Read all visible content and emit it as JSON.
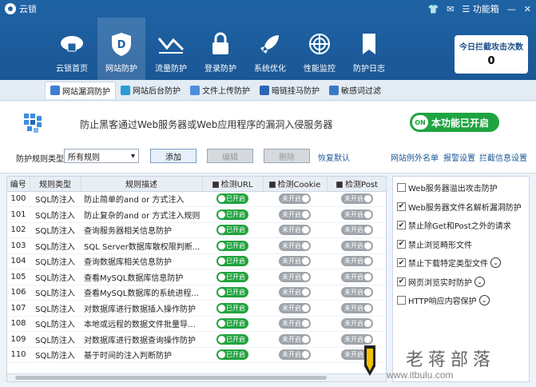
{
  "app": {
    "title": "云锁",
    "func_box": "功能箱"
  },
  "nav": [
    {
      "label": "云锁首页",
      "icon": "cloud-lock-icon",
      "active": false
    },
    {
      "label": "网站防护",
      "icon": "shield-icon",
      "active": true
    },
    {
      "label": "流量防护",
      "icon": "traffic-icon",
      "active": false
    },
    {
      "label": "登录防护",
      "icon": "lock-icon",
      "active": false
    },
    {
      "label": "系统优化",
      "icon": "rocket-icon",
      "active": false
    },
    {
      "label": "性能监控",
      "icon": "radar-icon",
      "active": false
    },
    {
      "label": "防护日志",
      "icon": "log-icon",
      "active": false
    }
  ],
  "counter": {
    "title": "今日拦截攻击次数",
    "value": "0"
  },
  "subtabs": [
    {
      "label": "网站漏洞防护",
      "active": true,
      "color": "#3d7fd0"
    },
    {
      "label": "网站后台防护",
      "active": false,
      "color": "#2a9ad8"
    },
    {
      "label": "文件上传防护",
      "active": false,
      "color": "#4d8de0"
    },
    {
      "label": "暗链挂马防护",
      "active": false,
      "color": "#2a66b8"
    },
    {
      "label": "敏感词过滤",
      "active": false,
      "color": "#3a78c4"
    }
  ],
  "header": {
    "description": "防止黑客通过Web服务器或Web应用程序的漏洞入侵服务器",
    "status_on": "ON",
    "status_text": "本功能已开启"
  },
  "controls": {
    "type_label": "防护规则类型",
    "type_value": "所有规则",
    "add": "添加",
    "edit": "编辑",
    "delete": "删除",
    "restore": "恢复默认",
    "link_exceptions": "网站例外名单",
    "link_alert": "报警设置",
    "link_block": "拦截信息设置"
  },
  "table": {
    "headers": {
      "id": "编号",
      "type": "规则类型",
      "desc": "规则描述",
      "url": "检测URL",
      "cookie": "检测Cookie",
      "post": "检测Post"
    },
    "on_label": "已开启",
    "off_label": "未开启",
    "rows": [
      {
        "id": "100",
        "type": "SQL防注入",
        "desc": "防止简单的and or 方式注入",
        "url": true,
        "cookie": false,
        "post": false
      },
      {
        "id": "101",
        "type": "SQL防注入",
        "desc": "防止复杂的and or 方式注入规则",
        "url": true,
        "cookie": false,
        "post": false
      },
      {
        "id": "102",
        "type": "SQL防注入",
        "desc": "查询服务器相关信息防护",
        "url": true,
        "cookie": false,
        "post": false
      },
      {
        "id": "103",
        "type": "SQL防注入",
        "desc": "SQL Server数据库散权限判断...",
        "url": true,
        "cookie": false,
        "post": false
      },
      {
        "id": "104",
        "type": "SQL防注入",
        "desc": "查询数据库相关信息防护",
        "url": true,
        "cookie": false,
        "post": false
      },
      {
        "id": "105",
        "type": "SQL防注入",
        "desc": "查看MySQL数据库信息防护",
        "url": true,
        "cookie": false,
        "post": false
      },
      {
        "id": "106",
        "type": "SQL防注入",
        "desc": "查看MySQL数据库的系统进程...",
        "url": true,
        "cookie": false,
        "post": false
      },
      {
        "id": "107",
        "type": "SQL防注入",
        "desc": "对数据库进行数据插入操作防护",
        "url": true,
        "cookie": false,
        "post": false
      },
      {
        "id": "108",
        "type": "SQL防注入",
        "desc": "本地或远程的数据文件批量导入...",
        "url": true,
        "cookie": false,
        "post": false
      },
      {
        "id": "109",
        "type": "SQL防注入",
        "desc": "对数据库进行数据查询操作防护",
        "url": true,
        "cookie": false,
        "post": false
      },
      {
        "id": "110",
        "type": "SQL防注入",
        "desc": "基于时间的注入判断防护",
        "url": true,
        "cookie": false,
        "post": false
      }
    ]
  },
  "options": [
    {
      "label": "Web服务器溢出攻击防护",
      "checked": false,
      "more": false
    },
    {
      "label": "Web服务器文件名解析漏洞防护",
      "checked": true,
      "more": false
    },
    {
      "label": "禁止除Get和Post之外的请求",
      "checked": true,
      "more": false
    },
    {
      "label": "禁止浏览畸形文件",
      "checked": true,
      "more": false
    },
    {
      "label": "禁止下载特定类型文件",
      "checked": true,
      "more": true
    },
    {
      "label": "网页浏览实时防护",
      "checked": true,
      "more": true
    },
    {
      "label": "HTTP响应内容保护",
      "checked": false,
      "more": true
    }
  ],
  "watermark": {
    "name": "老蒋部落",
    "url": "www.itbulu.com"
  }
}
